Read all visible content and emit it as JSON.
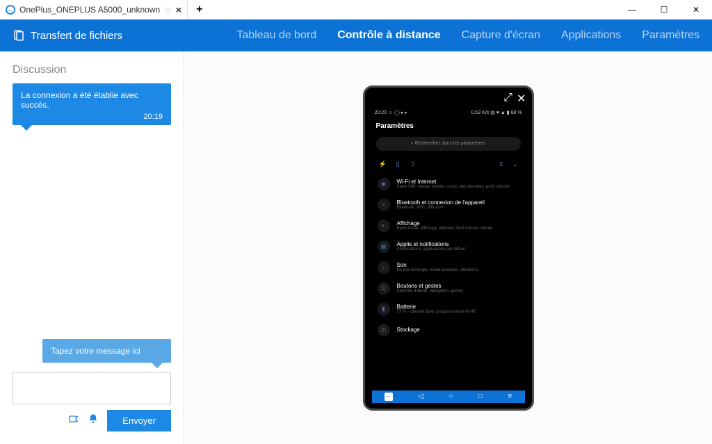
{
  "window": {
    "tab_title": "OnePlus_ONEPLUS A5000_unknown"
  },
  "header": {
    "file_transfer": "Transfert de fichiers",
    "tabs": {
      "dashboard": "Tableau de bord",
      "remote": "Contrôle à distance",
      "screenshot": "Capture d'écran",
      "apps": "Applications",
      "settings": "Paramètres"
    }
  },
  "chat": {
    "title": "Discussion",
    "msg": "La connexion a été établie avec succès.",
    "time": "20:19",
    "hint": "Tapez votre message ici",
    "send": "Envoyer"
  },
  "phone": {
    "status_left": "20:20  ☺ ◯ ▸ ▸",
    "status_right": "0.53 K/s ▤ ♥ ▲ ▮ 68 %",
    "title": "Paramètres",
    "search": "Rechercher dans les paramètres",
    "quick_count": "2",
    "items": [
      {
        "title": "Wi-Fi et Internet",
        "sub": "Carte SIM, réseau mobile, conso. des données, point d'accès"
      },
      {
        "title": "Bluetooth et connexion de l'appareil",
        "sub": "Bluetooth, NFC, diffusion"
      },
      {
        "title": "Affichage",
        "sub": "Barre d'état, affichage ambiant, fond d'écran, thème"
      },
      {
        "title": "Applis et notifications",
        "sub": "Autorisations, applications par défaut"
      },
      {
        "title": "Son",
        "sub": "Ne pas déranger, mode écouteur, vibrations"
      },
      {
        "title": "Boutons et gestes",
        "sub": "Contrôle d'alerte, navigation, gestes"
      },
      {
        "title": "Batterie",
        "sub": "37 % – Devrait durer jusqu'à environ 00:45"
      },
      {
        "title": "Stockage",
        "sub": ""
      }
    ]
  }
}
